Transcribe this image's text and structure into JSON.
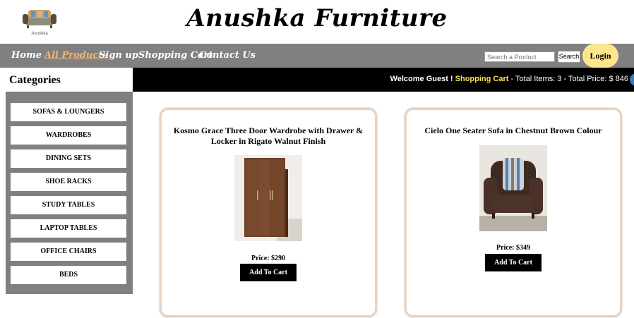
{
  "header": {
    "logo_text": "Anushka",
    "brand": "Anushka Furniture"
  },
  "nav": {
    "items": [
      {
        "label": "Home",
        "active": false
      },
      {
        "label": "All Products",
        "active": true
      },
      {
        "label": "Sign up",
        "active": false
      },
      {
        "label": "Shopping Cart",
        "active": false
      },
      {
        "label": "Contact Us",
        "active": false
      }
    ],
    "search_placeholder": "Search a Product",
    "search_button": "Search",
    "login_button": "Login"
  },
  "sidebar": {
    "title": "Categories",
    "categories": [
      "SOFAS & LOUNGERS",
      "WARDROBES",
      "DINING SETS",
      "SHOE RACKS",
      "STUDY TABLES",
      "LAPTOP TABLES",
      "OFFICE CHAIRS",
      "BEDS"
    ]
  },
  "welcome": {
    "greeting": "Welcome Guest ! ",
    "cart_link": "Shopping Cart",
    "summary": " - Total Items: 3 - Total Price: $ 846"
  },
  "products": [
    {
      "title": "Kosmo Grace Three Door Wardrobe with Drawer & Locker in Rigato Walnut Finish",
      "price": "Price: $290",
      "button": "Add To Cart"
    },
    {
      "title": "Cielo One Seater Sofa in Chestnut Brown Colour",
      "price": "Price: $349",
      "button": "Add To Cart"
    }
  ],
  "colors": {
    "nav_bg": "#808080",
    "active_nav": "#f6b26b",
    "login_bg": "#fde68a",
    "cart_link": "#fde047"
  }
}
